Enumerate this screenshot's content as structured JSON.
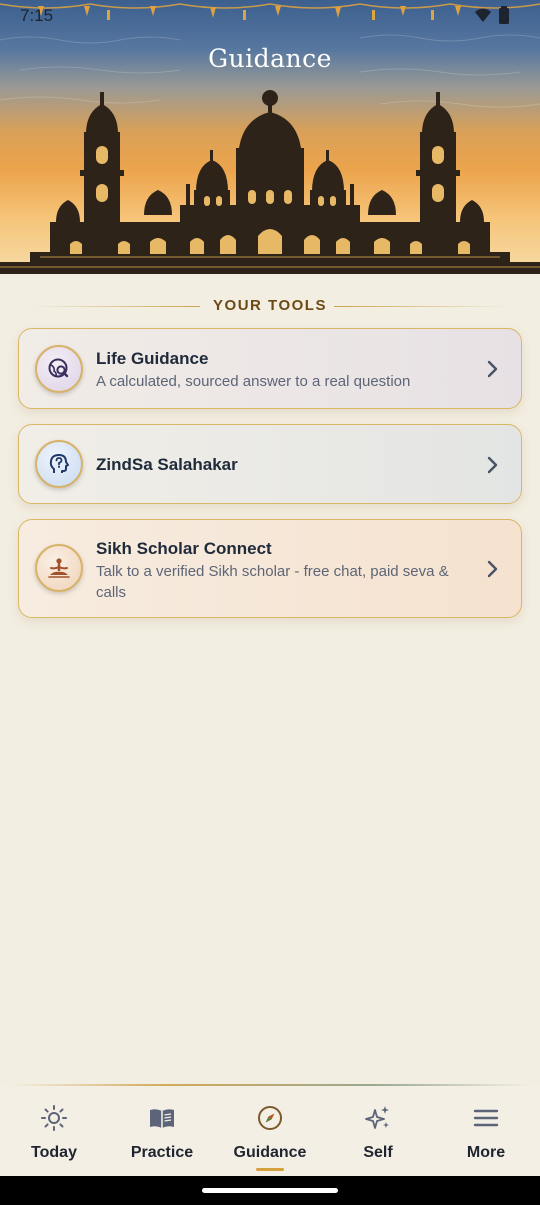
{
  "status_bar": {
    "time": "7:15"
  },
  "header": {
    "title": "Guidance"
  },
  "section": {
    "heading": "YOUR TOOLS"
  },
  "tools": [
    {
      "title": "Life Guidance",
      "subtitle": "A calculated, sourced answer to a real question",
      "icon": "globe-search-icon",
      "accent": "#e8e2e6"
    },
    {
      "title": "ZindSa Salahakar",
      "subtitle": "",
      "icon": "head-question-icon",
      "accent": "#e6e7e5"
    },
    {
      "title": "Sikh Scholar Connect",
      "subtitle": "Talk to a verified Sikh scholar - free chat, paid seva & calls",
      "icon": "meditation-icon",
      "accent": "#f6e4d1"
    }
  ],
  "bottom_nav": {
    "items": [
      {
        "label": "Today",
        "icon": "sun-icon"
      },
      {
        "label": "Practice",
        "icon": "book-icon"
      },
      {
        "label": "Guidance",
        "icon": "compass-icon",
        "active": true
      },
      {
        "label": "Self",
        "icon": "sparkles-icon"
      },
      {
        "label": "More",
        "icon": "menu-icon"
      }
    ]
  },
  "colors": {
    "background": "#f3eee2",
    "card_border": "#d8b865",
    "heading_text": "#6b4a15",
    "active_indicator": "#d4a13c"
  }
}
